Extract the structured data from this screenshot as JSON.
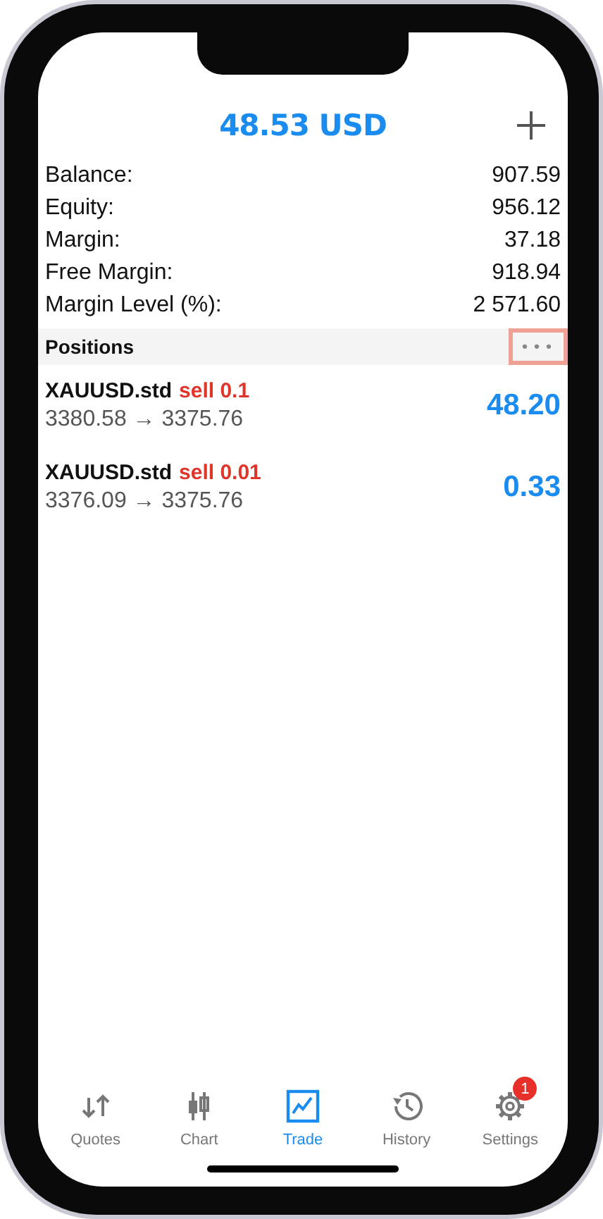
{
  "header": {
    "title": "48.53 USD"
  },
  "summary": [
    {
      "label": "Balance:",
      "value": "907.59"
    },
    {
      "label": "Equity:",
      "value": "956.12"
    },
    {
      "label": "Margin:",
      "value": "37.18"
    },
    {
      "label": "Free Margin:",
      "value": "918.94"
    },
    {
      "label": "Margin Level (%):",
      "value": "2 571.60"
    }
  ],
  "positions": {
    "title": "Positions",
    "more_button": {
      "label": "•••",
      "highlighted": true
    },
    "items": [
      {
        "symbol": "XAUUSD.std",
        "side": "sell 0.1",
        "prices": "3380.58 → 3375.76",
        "profit": "48.20"
      },
      {
        "symbol": "XAUUSD.std",
        "side": "sell 0.01",
        "prices": "3376.09 → 3375.76",
        "profit": "0.33"
      }
    ]
  },
  "tab_bar": [
    {
      "kind": "quotes",
      "label": "Quotes",
      "selected": false
    },
    {
      "kind": "chart",
      "label": "Chart",
      "selected": false
    },
    {
      "kind": "trade",
      "label": "Trade",
      "selected": true
    },
    {
      "kind": "history",
      "label": "History",
      "selected": false
    },
    {
      "kind": "settings",
      "label": "Settings",
      "selected": false,
      "badge": "1"
    }
  ]
}
